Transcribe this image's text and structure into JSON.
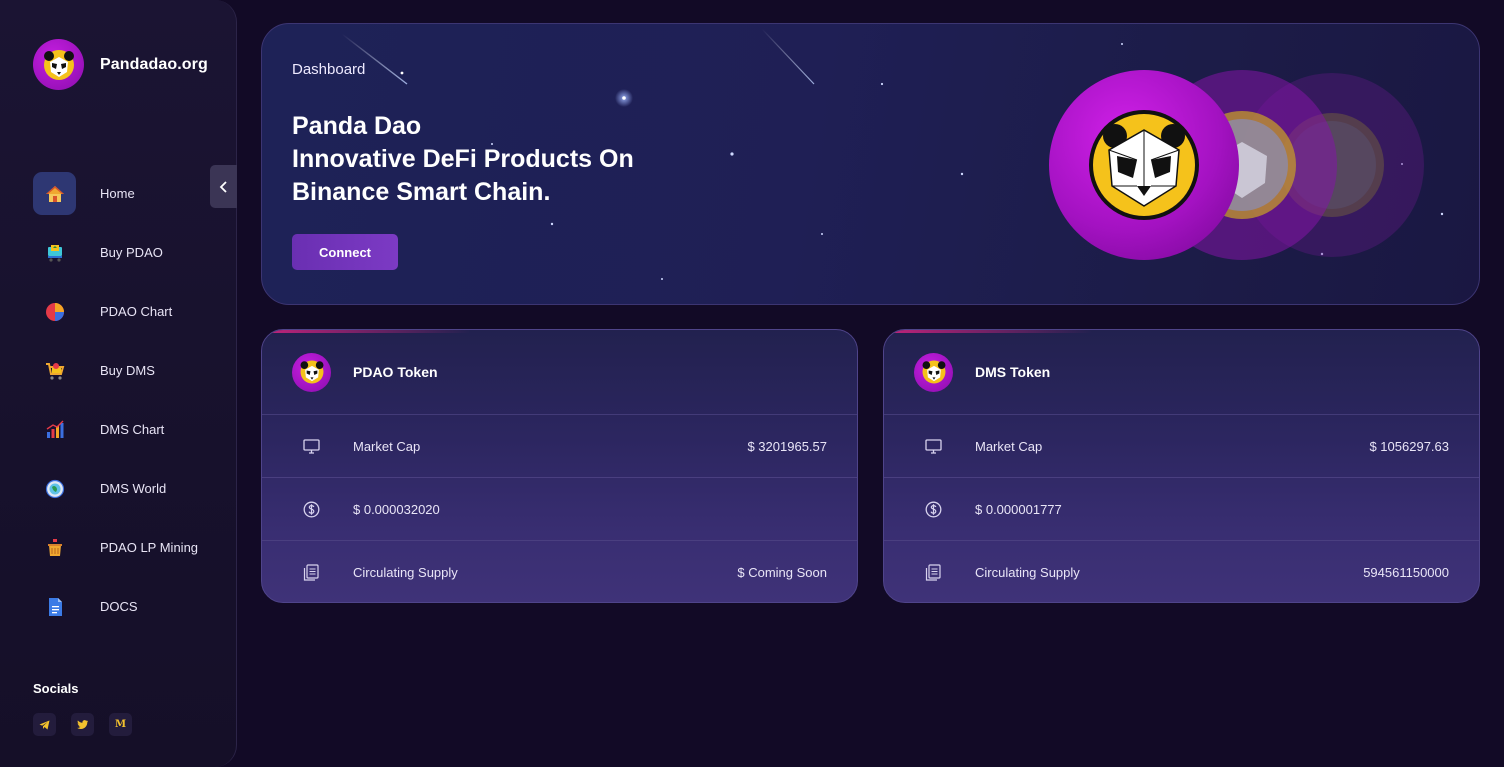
{
  "brand": {
    "name": "Pandadao.org"
  },
  "nav": [
    {
      "label": "Home",
      "icon": "home-icon",
      "active": true
    },
    {
      "label": "Buy PDAO",
      "icon": "cart-icon"
    },
    {
      "label": "PDAO Chart",
      "icon": "pie-chart-icon"
    },
    {
      "label": "Buy DMS",
      "icon": "shopping-cart-icon"
    },
    {
      "label": "DMS Chart",
      "icon": "bar-chart-icon"
    },
    {
      "label": "DMS World",
      "icon": "globe-icon"
    },
    {
      "label": "PDAO LP Mining",
      "icon": "basket-icon"
    },
    {
      "label": "DOCS",
      "icon": "document-icon"
    }
  ],
  "socials": {
    "title": "Socials",
    "items": [
      {
        "name": "telegram-icon",
        "glyph": ""
      },
      {
        "name": "twitter-icon",
        "glyph": ""
      },
      {
        "name": "medium-icon",
        "glyph": "M"
      }
    ]
  },
  "hero": {
    "label": "Dashboard",
    "title_lines": [
      "Panda Dao",
      "Innovative DeFi Products On",
      "Binance Smart Chain."
    ],
    "connect_label": "Connect"
  },
  "cards": [
    {
      "title": "PDAO Token",
      "rows": [
        {
          "icon": "monitor-icon",
          "label": "Market Cap",
          "value": "$ 3201965.57"
        },
        {
          "icon": "dollar-icon",
          "label": "$ 0.000032020",
          "value": ""
        },
        {
          "icon": "document-stack-icon",
          "label": "Circulating Supply",
          "value": "$ Coming Soon"
        }
      ]
    },
    {
      "title": "DMS Token",
      "rows": [
        {
          "icon": "monitor-icon",
          "label": "Market Cap",
          "value": "$ 1056297.63"
        },
        {
          "icon": "dollar-icon",
          "label": "$ 0.000001777",
          "value": ""
        },
        {
          "icon": "document-stack-icon",
          "label": "Circulating Supply",
          "value": "594561150000"
        }
      ]
    }
  ],
  "colors": {
    "background": "#120a26",
    "accent_purple": "#9c12bc",
    "button_purple": "#6a2fb2",
    "coin_gold": "#f2c12e"
  }
}
